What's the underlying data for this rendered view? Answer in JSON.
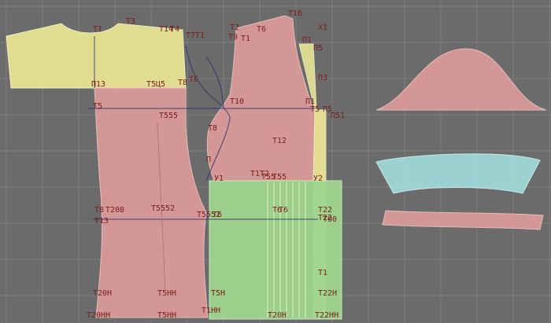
{
  "colors": {
    "background": "#6b6b6b",
    "grid": "#7c7c7c",
    "piece_yellow": "#e8e493",
    "piece_pink": "#d99a98",
    "piece_green": "#9fd58e",
    "piece_teal": "#9fd7d7",
    "label": "#7a1e1e",
    "construction_line": "#2a2f6a"
  },
  "pieces": [
    {
      "name": "yoke",
      "color": "yellow"
    },
    {
      "name": "back-panel",
      "color": "pink"
    },
    {
      "name": "front-panel",
      "color": "pink"
    },
    {
      "name": "side-strip",
      "color": "yellow"
    },
    {
      "name": "bottom-panel",
      "color": "green"
    },
    {
      "name": "sleeve",
      "color": "pink"
    },
    {
      "name": "collar-band",
      "color": "teal"
    },
    {
      "name": "waist-strip",
      "color": "pink"
    }
  ],
  "labels": [
    "Т3",
    "Т1",
    "Т14",
    "Т4",
    "Т7",
    "Т1",
    "Т2",
    "Т9",
    "Т1",
    "Т6",
    "Т16",
    "Х1",
    "П1",
    "П5",
    "П3",
    "П13",
    "Т5Ц5",
    "Т8",
    "Т6",
    "П1",
    "Т10",
    "Т5",
    "П5",
    "П51",
    "Т555",
    "Т8",
    "Т12",
    "Т5",
    "П",
    "У1",
    "У2",
    "Т1Т2",
    "Т55",
    "Т55",
    "Т6",
    "Т22",
    "Т8",
    "Т13",
    "Т208",
    "Т5552",
    "Т5552",
    "Т6",
    "Т6",
    "Т22",
    "Т00",
    "Т20Н",
    "Т5НН",
    "Т5Н",
    "Т1",
    "Т22Н",
    "Т20НН",
    "Т5НН",
    "Т1НН",
    "Т20Н",
    "Т22НН"
  ]
}
